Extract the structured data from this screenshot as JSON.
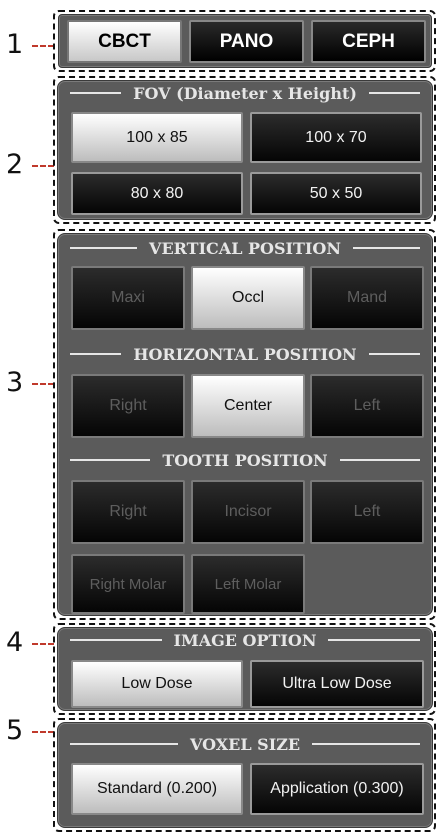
{
  "callouts": [
    "1",
    "2",
    "3",
    "4",
    "5"
  ],
  "modes": [
    {
      "label": "CBCT",
      "active": true
    },
    {
      "label": "PANO",
      "active": false
    },
    {
      "label": "CEPH",
      "active": false
    }
  ],
  "fov": {
    "title": "FOV (Diameter x Height)",
    "options": [
      {
        "label": "100 x 85",
        "selected": true
      },
      {
        "label": "100 x 70",
        "selected": false
      },
      {
        "label": "80 x 80",
        "selected": false
      },
      {
        "label": "50 x 50",
        "selected": false
      }
    ]
  },
  "vertical": {
    "title": "VERTICAL POSITION",
    "options": [
      {
        "label": "Maxi",
        "state": "disabled"
      },
      {
        "label": "Occl",
        "state": "selected"
      },
      {
        "label": "Mand",
        "state": "disabled"
      }
    ]
  },
  "horizontal": {
    "title": "HORIZONTAL POSITION",
    "options": [
      {
        "label": "Right",
        "state": "disabled"
      },
      {
        "label": "Center",
        "state": "selected"
      },
      {
        "label": "Left",
        "state": "disabled"
      }
    ]
  },
  "tooth": {
    "title": "TOOTH POSITION",
    "options": [
      {
        "label": "Right",
        "state": "disabled"
      },
      {
        "label": "Incisor",
        "state": "disabled"
      },
      {
        "label": "Left",
        "state": "disabled"
      },
      {
        "label": "Right Molar",
        "state": "disabled"
      },
      {
        "label": "Left Molar",
        "state": "disabled"
      }
    ]
  },
  "image_option": {
    "title": "IMAGE OPTION",
    "options": [
      {
        "label": "Low Dose",
        "selected": true
      },
      {
        "label": "Ultra Low Dose",
        "selected": false
      }
    ]
  },
  "voxel": {
    "title": "VOXEL SIZE",
    "options": [
      {
        "label": "Standard (0.200)",
        "selected": true
      },
      {
        "label": "Application (0.300)",
        "selected": false
      }
    ]
  }
}
